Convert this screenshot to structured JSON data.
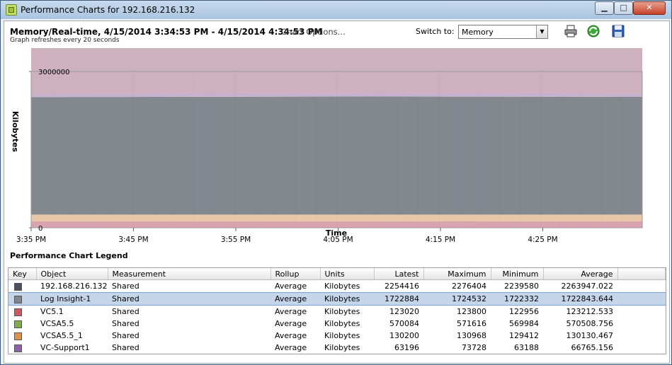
{
  "window": {
    "title": "Performance Charts for 192.168.216.132"
  },
  "header": {
    "title": "Memory/Real-time, 4/15/2014 3:34:53 PM - 4/15/2014 4:34:53 PM",
    "chart_options": "Chart Options...",
    "subtitle": "Graph refreshes every 20 seconds",
    "switch_label": "Switch to:",
    "switch_value": "Memory"
  },
  "toolbar": {
    "print": "printer-icon",
    "refresh": "refresh-icon",
    "save": "save-icon"
  },
  "chart_data": {
    "type": "area",
    "stacked": true,
    "xlabel": "Time",
    "ylabel": "Kilobytes",
    "x_ticks": [
      "3:35 PM",
      "3:45 PM",
      "3:55 PM",
      "4:05 PM",
      "4:15 PM",
      "4:25 PM"
    ],
    "y_ticks": [
      "3000000",
      "0"
    ],
    "ylim": [
      0,
      3000000
    ],
    "grid": true,
    "series": [
      {
        "name": "192.168.216.132",
        "color": "#757b83",
        "values": [
          2254416,
          2256000,
          2260000,
          2262000,
          2265000,
          2263000,
          2261000,
          2258000
        ]
      },
      {
        "name": "Log Insight-1",
        "color": "#c9a7b7",
        "values": [
          1722884,
          1722600,
          1723000,
          1724000,
          1723500,
          1722800,
          1723300,
          1722900
        ]
      },
      {
        "name": "VC5.1",
        "color": "#d59aa6",
        "values": [
          123020,
          123400,
          123200,
          123600,
          123100,
          122980,
          123300,
          123020
        ]
      },
      {
        "name": "VCSA5.5",
        "color": "#bfcf98",
        "values": [
          570084,
          570400,
          570900,
          570200,
          571000,
          570600,
          570300,
          570084
        ]
      },
      {
        "name": "VCSA5.5_1",
        "color": "#e3c29e",
        "values": [
          130200,
          130100,
          130300,
          130000,
          130250,
          130150,
          130180,
          130200
        ]
      },
      {
        "name": "VC-Support1",
        "color": "#bfa7c8",
        "values": [
          63196,
          66000,
          72000,
          65000,
          68000,
          63500,
          67000,
          63196
        ]
      }
    ]
  },
  "legend": {
    "title": "Performance Chart Legend",
    "columns": [
      "Key",
      "Object",
      "Measurement",
      "Rollup",
      "Units",
      "Latest",
      "Maximum",
      "Minimum",
      "Average"
    ],
    "rows": [
      {
        "color": "#4c505a",
        "object": "192.168.216.132",
        "measurement": "Shared",
        "rollup": "Average",
        "units": "Kilobytes",
        "latest": "2254416",
        "maximum": "2276404",
        "minimum": "2239580",
        "average": "2263947.022"
      },
      {
        "color": "#7e8690",
        "object": "Log Insight-1",
        "measurement": "Shared",
        "rollup": "Average",
        "units": "Kilobytes",
        "latest": "1722884",
        "maximum": "1724532",
        "minimum": "1722332",
        "average": "1722843.644"
      },
      {
        "color": "#d0575e",
        "object": "VC5.1",
        "measurement": "Shared",
        "rollup": "Average",
        "units": "Kilobytes",
        "latest": "123020",
        "maximum": "123800",
        "minimum": "122956",
        "average": "123212.533"
      },
      {
        "color": "#7fae4a",
        "object": "VCSA5.5",
        "measurement": "Shared",
        "rollup": "Average",
        "units": "Kilobytes",
        "latest": "570084",
        "maximum": "571616",
        "minimum": "569984",
        "average": "570508.756"
      },
      {
        "color": "#e0914a",
        "object": "VCSA5.5_1",
        "measurement": "Shared",
        "rollup": "Average",
        "units": "Kilobytes",
        "latest": "130200",
        "maximum": "130968",
        "minimum": "129412",
        "average": "130130.467"
      },
      {
        "color": "#8e62a8",
        "object": "VC-Support1",
        "measurement": "Shared",
        "rollup": "Average",
        "units": "Kilobytes",
        "latest": "63196",
        "maximum": "73728",
        "minimum": "63188",
        "average": "66765.156"
      }
    ],
    "selected_index": 1
  }
}
